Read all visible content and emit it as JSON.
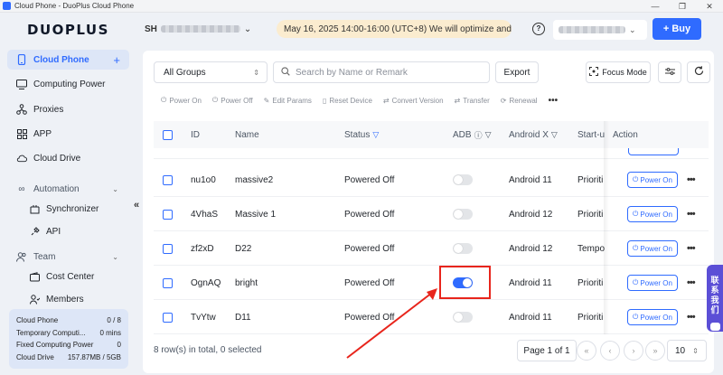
{
  "window": {
    "title": "Cloud Phone - DuoPlus Cloud Phone",
    "controls": [
      "—",
      "❐",
      "✕"
    ]
  },
  "header": {
    "logo": "DUOPLUS",
    "account_prefix": "SH",
    "notice": "May 16, 2025 14:00-16:00 (UTC+8) We will optimize and...",
    "help_glyph": "?",
    "buy_label": "Buy",
    "buy_plus": "+"
  },
  "sidebar": {
    "items": [
      {
        "label": "Cloud Phone",
        "icon": "mobile-icon"
      },
      {
        "label": "Computing Power",
        "icon": "monitor-icon"
      },
      {
        "label": "Proxies",
        "icon": "network-icon"
      },
      {
        "label": "APP",
        "icon": "grid-icon"
      },
      {
        "label": "Cloud Drive",
        "icon": "cloud-icon"
      }
    ],
    "automation": {
      "label": "Automation",
      "children": [
        "Synchronizer",
        "API"
      ]
    },
    "team": {
      "label": "Team",
      "children": [
        "Cost Center",
        "Members"
      ]
    },
    "usage": [
      {
        "label": "Cloud Phone",
        "value": "0 / 8"
      },
      {
        "label": "Temporary Computi...",
        "value": "0 mins"
      },
      {
        "label": "Fixed Computing Power",
        "value": "0"
      },
      {
        "label": "Cloud Drive",
        "value": "157.87MB / 5GB"
      }
    ],
    "collapse_glyph": "«"
  },
  "toolbar": {
    "group_select": "All Groups",
    "search_placeholder": "Search by Name or Remark",
    "export_label": "Export",
    "focus_label": "Focus Mode"
  },
  "actions": [
    {
      "label": "Power On",
      "glyph": "⏻"
    },
    {
      "label": "Power Off",
      "glyph": "⏻"
    },
    {
      "label": "Edit Params",
      "glyph": "✎"
    },
    {
      "label": "Reset Device",
      "glyph": "▯"
    },
    {
      "label": "Convert Version",
      "glyph": "⇄"
    },
    {
      "label": "Transfer",
      "glyph": "⇄"
    },
    {
      "label": "Renewal",
      "glyph": "⟳"
    }
  ],
  "actions_more": "•••",
  "table": {
    "columns": {
      "id": "ID",
      "name": "Name",
      "status": "Status",
      "adb": "ADB",
      "android": "Android X",
      "startup": "Start-u",
      "action": "Action"
    },
    "rows": [
      {
        "id": "nu1o0",
        "name": "massive2",
        "status": "Powered Off",
        "adb_on": false,
        "android": "Android 11",
        "startup": "Prioriti",
        "action": "Power On"
      },
      {
        "id": "4VhaS",
        "name": "Massive 1",
        "status": "Powered Off",
        "adb_on": false,
        "android": "Android 12",
        "startup": "Prioriti",
        "action": "Power On"
      },
      {
        "id": "zf2xD",
        "name": "D22",
        "status": "Powered Off",
        "adb_on": false,
        "android": "Android 12",
        "startup": "Tempo",
        "action": "Power On"
      },
      {
        "id": "OgnAQ",
        "name": "bright",
        "status": "Powered Off",
        "adb_on": true,
        "android": "Android 11",
        "startup": "Prioriti",
        "action": "Power On"
      },
      {
        "id": "TvYtw",
        "name": "D11",
        "status": "Powered Off",
        "adb_on": false,
        "android": "Android 11",
        "startup": "Prioriti",
        "action": "Power On"
      }
    ]
  },
  "footer": {
    "total": "8 row(s) in total, 0 selected",
    "page": "Page 1 of 1",
    "page_size": "10"
  },
  "contact": {
    "label": [
      "联",
      "系",
      "我",
      "们"
    ]
  },
  "colors": {
    "accent": "#2f6bff",
    "highlight": "#e8251c",
    "notice_bg": "#fbeccf"
  }
}
